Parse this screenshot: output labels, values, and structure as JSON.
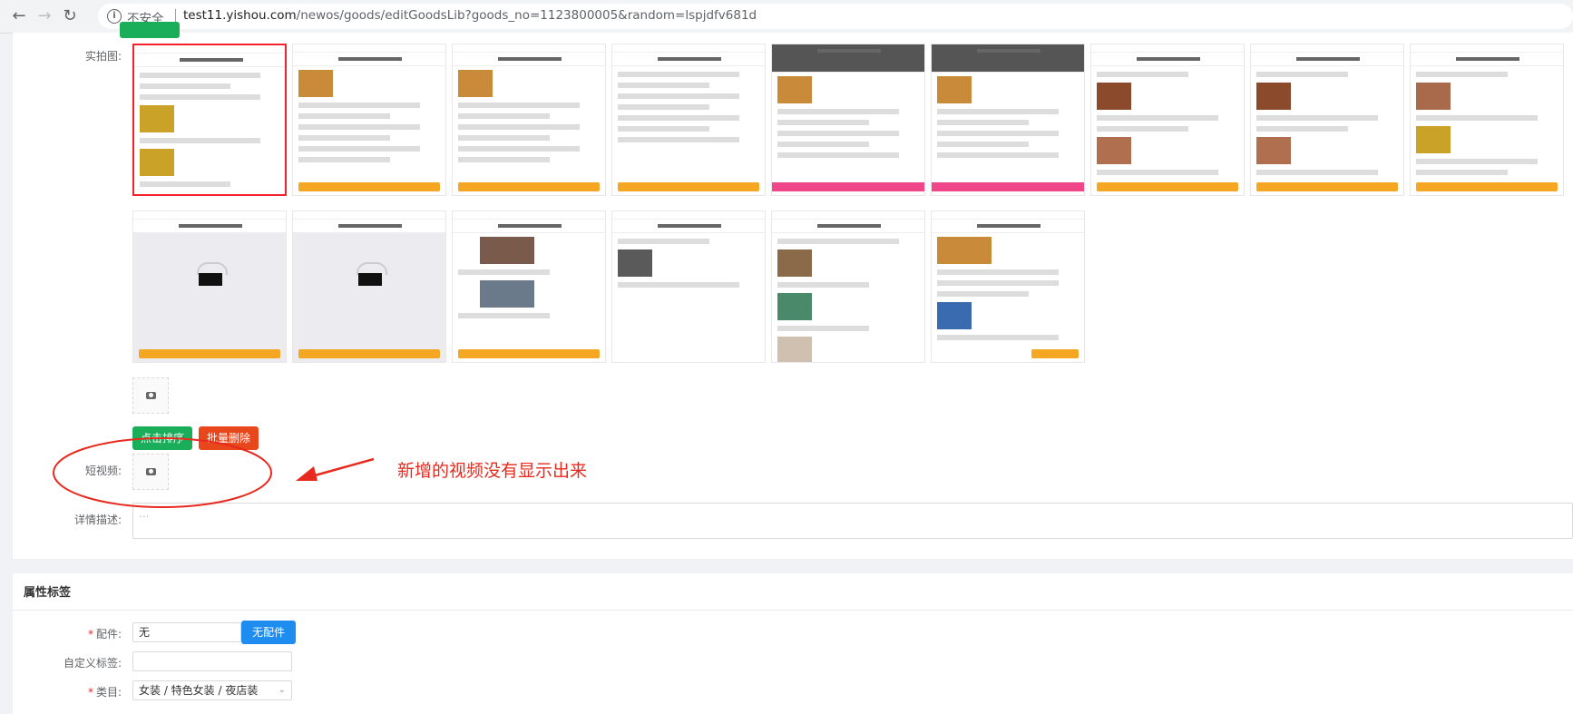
{
  "browser": {
    "insecure_label": "不安全",
    "url_host": "test11.yishou.com",
    "url_path": "/newos/goods/editGoodsLib?goods_no=1123800005&random=lspjdfv681d"
  },
  "form": {
    "photos_label": "实拍图:",
    "sort_button": "点击排序",
    "batch_delete_button": "批量删除",
    "video_label": "短视频:",
    "detail_label": "详情描述:",
    "detail_placeholder": "..."
  },
  "annotation": {
    "text": "新增的视频没有显示出来",
    "color": "#e8291e"
  },
  "attributes": {
    "section_title": "属性标签",
    "accessory_label": "配件:",
    "accessory_value": "无",
    "no_accessory_button": "无配件",
    "custom_tag_label": "自定义标签:",
    "custom_tag_value": "",
    "category_label": "类目:",
    "category_value": "女装 / 特色女装 / 夜店装"
  },
  "colors": {
    "green": "#1aad5a",
    "red": "#e8471c",
    "blue": "#1f8cf0"
  }
}
